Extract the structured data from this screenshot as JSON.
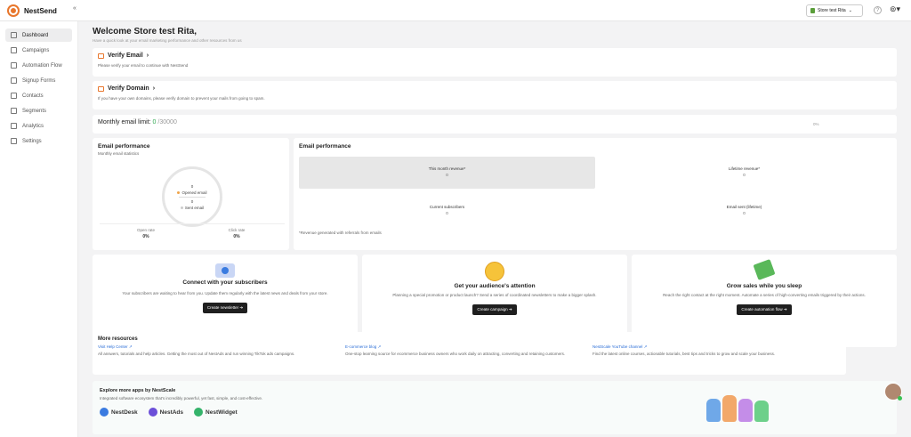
{
  "app": {
    "name": "NestSend"
  },
  "topbar": {
    "store_label": "Store test Rita",
    "help_label": "?"
  },
  "sidebar": {
    "items": [
      {
        "label": "Dashboard"
      },
      {
        "label": "Campaigns"
      },
      {
        "label": "Automation Flow"
      },
      {
        "label": "Signup Forms"
      },
      {
        "label": "Contacts"
      },
      {
        "label": "Segments"
      },
      {
        "label": "Analytics"
      },
      {
        "label": "Settings"
      }
    ]
  },
  "welcome": {
    "title": "Welcome Store test Rita,",
    "subtitle": "Have a quick look at your email marketing performance and other resources from us"
  },
  "verify_email": {
    "title": "Verify Email",
    "text": "Please verify your email to continue with NestSend"
  },
  "verify_domain": {
    "title": "Verify Domain",
    "text": "If you have your own domains, please verify domain to prevent your mails from going to spam."
  },
  "limit": {
    "label": "Monthly email limit:",
    "used": "0",
    "total": "/30000",
    "percent": "0%",
    "fill_fraction": 0
  },
  "perf_left": {
    "title": "Email performance",
    "subtitle": "Monthly email statistics",
    "opened_value": "0",
    "opened_label": "Opened email",
    "sent_value": "0",
    "sent_label": "Sent email",
    "open_rate_label": "Open rate",
    "open_rate_value": "0%",
    "click_rate_label": "Click rate",
    "click_rate_value": "0%"
  },
  "perf_right": {
    "title": "Email performance",
    "this_month_label": "This month revenue*",
    "this_month_value": "0",
    "lifetime_label": "Lifetime revenue*",
    "lifetime_value": "0",
    "subscribers_label": "Current subscribers",
    "subscribers_value": "0",
    "sent_life_label": "Email sent (lifetime)",
    "sent_life_value": "0",
    "note": "*Revenue generated with referrals from emails"
  },
  "promos": [
    {
      "title": "Connect with your subscribers",
      "text": "Your subscribers are waiting to hear from you. Update them regularly with the latest news and deals from your store.",
      "button": "Create newsletter ➔"
    },
    {
      "title": "Get your audience's attention",
      "text": "Planning a special promotion or product launch? Send a series of coordinated newsletters to make a bigger splash.",
      "button": "Create campaign ➔"
    },
    {
      "title": "Grow sales while you sleep",
      "text": "Reach the right contact at the right moment. Automate a series of high-converting emails triggered by their actions.",
      "button": "Create automation flow ➔"
    }
  ],
  "resources": {
    "title": "More resources",
    "items": [
      {
        "link": "Visit Help Center ↗",
        "text": "All answers, tutorials and help articles. Getting the most out of NestAds and run winning TikTok ads campaigns."
      },
      {
        "link": "E-commerce blog ↗",
        "text": "One-stop learning source for ecommerce business owners who work daily on attracting, converting and retaining customers."
      },
      {
        "link": "NestScale YouTube channel ↗",
        "text": "Find the latest online courses, actionable tutorials, best tips and tricks to grow and scale your business."
      }
    ]
  },
  "apps": {
    "title": "Explore more apps by NestScale",
    "text": "Integrated software ecosystem that's incredibly powerful, yet fast, simple, and cost-effective.",
    "items": [
      {
        "name": "NestDesk",
        "color": "#3a7be0"
      },
      {
        "name": "NestAds",
        "color": "#6b4fd8"
      },
      {
        "name": "NestWidget",
        "color": "#34b36a"
      }
    ]
  },
  "colors": {
    "accent": "#e8762c",
    "link": "#2a6dd6",
    "button": "#1f1f1f"
  }
}
